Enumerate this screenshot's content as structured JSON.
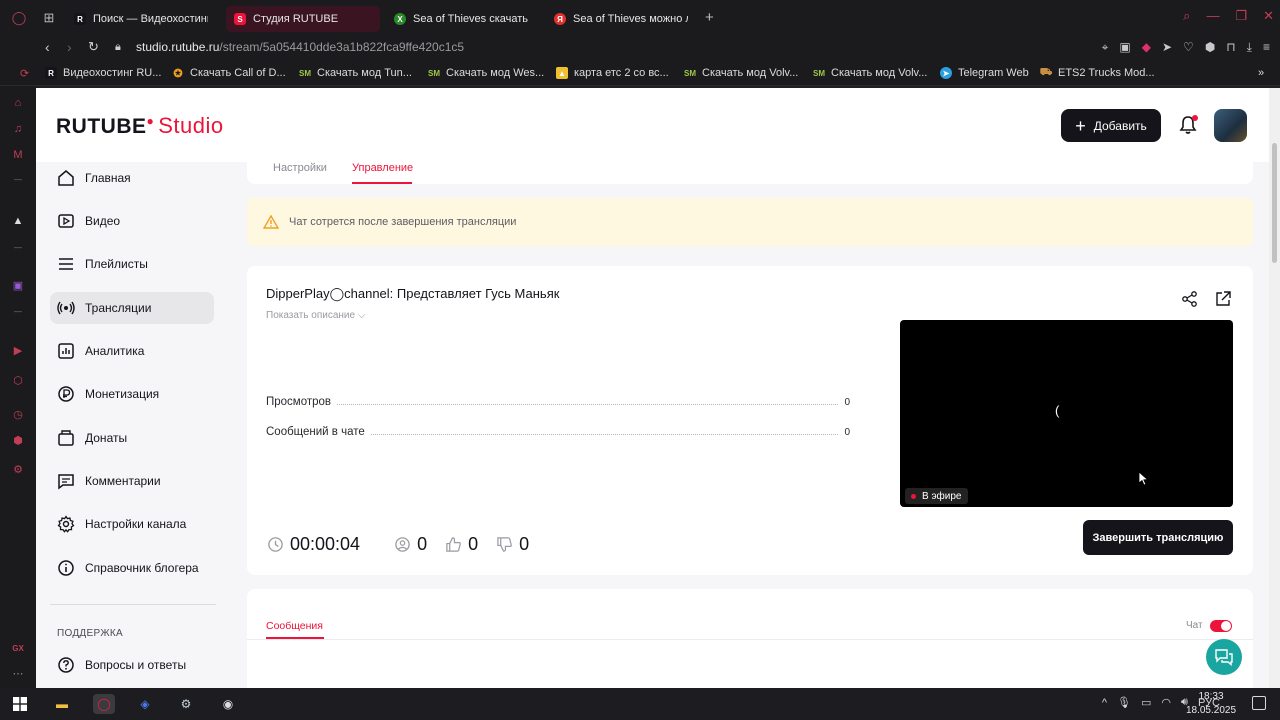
{
  "browser": {
    "tabs": [
      {
        "label": "Поиск — Видеохостинг R",
        "icon": "rutube-icon",
        "active": false
      },
      {
        "label": "Студия RUTUBE",
        "icon": "rutube-studio-icon",
        "active": true
      },
      {
        "label": "Sea of Thieves скачать т",
        "icon": "xbox-icon",
        "active": false
      },
      {
        "label": "Sea of Thieves можно ли",
        "icon": "yandex-icon",
        "active": false
      }
    ],
    "new_tab": "+",
    "url_host": "studio.rutube.ru",
    "url_path": "/stream/5a054410dde3a1b822fca9ffe420c1c5",
    "bookmarks": [
      {
        "label": "Видеохостинг RU...",
        "icon": "rutube-icon"
      },
      {
        "label": "Скачать Call of D...",
        "icon": "game-icon"
      },
      {
        "label": "Скачать мод Tun...",
        "icon": "mod-icon"
      },
      {
        "label": "Скачать мод Wes...",
        "icon": "mod-icon"
      },
      {
        "label": "карта етс 2 со вс...",
        "icon": "map-icon"
      },
      {
        "label": "Скачать мод Volv...",
        "icon": "mod-icon"
      },
      {
        "label": "Скачать мод Volv...",
        "icon": "mod-icon"
      },
      {
        "label": "Telegram Web",
        "icon": "telegram-icon"
      },
      {
        "label": "ETS2 Trucks Mod...",
        "icon": "truck-icon"
      }
    ]
  },
  "header": {
    "logo_text": "RUTUBE",
    "logo_suffix": "Studio",
    "add_label": "Добавить"
  },
  "sidebar": {
    "items": [
      {
        "label": "Главная",
        "icon": "home-icon"
      },
      {
        "label": "Видео",
        "icon": "video-icon"
      },
      {
        "label": "Плейлисты",
        "icon": "playlist-icon"
      },
      {
        "label": "Трансляции",
        "icon": "broadcast-icon",
        "active": true
      },
      {
        "label": "Аналитика",
        "icon": "analytics-icon"
      },
      {
        "label": "Монетизация",
        "icon": "ruble-icon"
      },
      {
        "label": "Донаты",
        "icon": "donate-icon"
      },
      {
        "label": "Комментарии",
        "icon": "comment-icon"
      },
      {
        "label": "Настройки канала",
        "icon": "gear-icon"
      },
      {
        "label": "Справочник блогера",
        "icon": "info-icon"
      }
    ],
    "support_heading": "ПОДДЕРЖКА",
    "support_items": [
      {
        "label": "Вопросы и ответы",
        "icon": "question-icon"
      }
    ]
  },
  "page_tabs": {
    "settings": "Настройки",
    "manage": "Управление"
  },
  "warning": {
    "text": "Чат сотрется после завершения трансляции"
  },
  "stream": {
    "title": "DipperPlay◯channel: Представляет Гусь Маньяк",
    "show_description": "Показать описание",
    "stats": [
      {
        "label": "Просмотров",
        "value": "0"
      },
      {
        "label": "Сообщений в чате",
        "value": "0"
      }
    ],
    "live_badge": "В эфире",
    "spinner_glyph": "(",
    "duration": "00:00:04",
    "viewers": "0",
    "likes": "0",
    "dislikes": "0",
    "end_label": "Завершить трансляцию"
  },
  "chat": {
    "tab_label": "Сообщения",
    "toggle_label": "Чат",
    "toggle_on": true
  },
  "taskbar": {
    "language": "РУС",
    "time": "18:33",
    "date": "18.05.2025"
  },
  "colors": {
    "accent": "#ed143b",
    "dark": "#14141a",
    "warning_bg": "#fff8e1",
    "help_fab": "#1aa6a0"
  }
}
